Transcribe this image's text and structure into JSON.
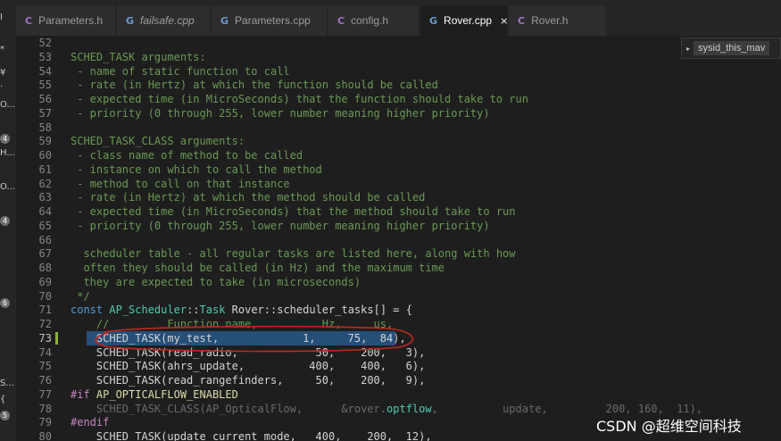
{
  "leftbar": {
    "items": [
      {
        "text": "Ï",
        "kind": "text"
      },
      {
        "text": "*",
        "kind": "text"
      },
      {
        "text": "¥",
        "kind": "text"
      },
      {
        "text": "·",
        "kind": "text"
      },
      {
        "text": "O...",
        "kind": "text"
      },
      {
        "text": "4",
        "kind": "badge"
      },
      {
        "text": "H...",
        "kind": "text"
      },
      {
        "text": "O...",
        "kind": "text"
      },
      {
        "text": "4",
        "kind": "badge"
      },
      {
        "text": "6",
        "kind": "badge"
      },
      {
        "text": "S...",
        "kind": "text"
      },
      {
        "text": "{",
        "kind": "text"
      },
      {
        "text": "5",
        "kind": "badge"
      }
    ]
  },
  "tabs": [
    {
      "label": "Parameters.h",
      "icon": "C",
      "lang": "c",
      "italic": false,
      "active": false
    },
    {
      "label": "failsafe.cpp",
      "icon": "G",
      "lang": "cpp",
      "italic": true,
      "active": false
    },
    {
      "label": "Parameters.cpp",
      "icon": "G",
      "lang": "cpp",
      "italic": false,
      "active": false
    },
    {
      "label": "config.h",
      "icon": "C",
      "lang": "c",
      "italic": false,
      "active": false
    },
    {
      "label": "Rover.cpp",
      "icon": "G",
      "lang": "cpp",
      "italic": false,
      "active": true,
      "close": "×"
    },
    {
      "label": "Rover.h",
      "icon": "C",
      "lang": "c",
      "italic": false,
      "active": false
    }
  ],
  "outline": {
    "arrow": "▸",
    "label": "sysid_this_mav"
  },
  "editor": {
    "active_line": 73,
    "lines": [
      {
        "n": 52,
        "tokens": []
      },
      {
        "n": 53,
        "tokens": [
          {
            "t": "SCHED_TASK arguments:",
            "c": "comment"
          }
        ]
      },
      {
        "n": 54,
        "tokens": [
          {
            "t": " - name of static function to call",
            "c": "comment"
          }
        ]
      },
      {
        "n": 55,
        "tokens": [
          {
            "t": " - rate (in Hertz) at which the function should be called",
            "c": "comment"
          }
        ]
      },
      {
        "n": 56,
        "tokens": [
          {
            "t": " - expected time (in MicroSeconds) that the function should take to run",
            "c": "comment"
          }
        ]
      },
      {
        "n": 57,
        "tokens": [
          {
            "t": " - priority (0 through 255, lower number meaning higher priority)",
            "c": "comment"
          }
        ]
      },
      {
        "n": 58,
        "tokens": []
      },
      {
        "n": 59,
        "tokens": [
          {
            "t": "SCHED_TASK_CLASS arguments:",
            "c": "comment"
          }
        ]
      },
      {
        "n": 60,
        "tokens": [
          {
            "t": " - class name of method to be called",
            "c": "comment"
          }
        ]
      },
      {
        "n": 61,
        "tokens": [
          {
            "t": " - instance on which to call the method",
            "c": "comment"
          }
        ]
      },
      {
        "n": 62,
        "tokens": [
          {
            "t": " - method to call on that instance",
            "c": "comment"
          }
        ]
      },
      {
        "n": 63,
        "tokens": [
          {
            "t": " - rate (in Hertz) at which the method should be called",
            "c": "comment"
          }
        ]
      },
      {
        "n": 64,
        "tokens": [
          {
            "t": " - expected time (in MicroSeconds) that the method should take to run",
            "c": "comment"
          }
        ]
      },
      {
        "n": 65,
        "tokens": [
          {
            "t": " - priority (0 through 255, lower number meaning higher priority)",
            "c": "comment"
          }
        ]
      },
      {
        "n": 66,
        "tokens": []
      },
      {
        "n": 67,
        "tokens": [
          {
            "t": "  scheduler table - all regular tasks are listed here, along with how",
            "c": "comment"
          }
        ]
      },
      {
        "n": 68,
        "tokens": [
          {
            "t": "  often they should be called (in Hz) and the maximum time",
            "c": "comment"
          }
        ]
      },
      {
        "n": 69,
        "tokens": [
          {
            "t": "  they are expected to take (in microseconds)",
            "c": "comment"
          }
        ]
      },
      {
        "n": 70,
        "tokens": [
          {
            "t": " */",
            "c": "comment"
          }
        ]
      },
      {
        "n": 71,
        "tokens": [
          {
            "t": "const ",
            "c": "keyword"
          },
          {
            "t": "AP_Scheduler",
            "c": "type"
          },
          {
            "t": "::",
            "c": "plain"
          },
          {
            "t": "Task",
            "c": "type"
          },
          {
            "t": " Rover::scheduler_tasks[] = {",
            "c": "plain"
          }
        ]
      },
      {
        "n": 72,
        "tokens": [
          {
            "t": "    //         Function name,          Hz,     us,",
            "c": "comment"
          }
        ]
      },
      {
        "n": 73,
        "tokens": [
          {
            "t": "    SCHED_TASK(my_test,             1,     75,  84),",
            "c": "plain"
          }
        ]
      },
      {
        "n": 74,
        "tokens": [
          {
            "t": "    SCHED_TASK(read_radio,            50,    200,   3),",
            "c": "plain"
          }
        ]
      },
      {
        "n": 75,
        "tokens": [
          {
            "t": "    SCHED_TASK(ahrs_update,          400,    400,   6),",
            "c": "plain"
          }
        ]
      },
      {
        "n": 76,
        "tokens": [
          {
            "t": "    SCHED_TASK(read_rangefinders,     50,    200,   9),",
            "c": "plain"
          }
        ]
      },
      {
        "n": 77,
        "tokens": [
          {
            "t": "#if ",
            "c": "preproc"
          },
          {
            "t": "AP_OPTICALFLOW_ENABLED",
            "c": "macro"
          }
        ]
      },
      {
        "n": 78,
        "tokens": [
          {
            "t": "    SCHED_TASK_CLASS(AP_OpticalFlow,      &rover.",
            "c": "dim"
          },
          {
            "t": "optflow",
            "c": "type"
          },
          {
            "t": ",          update,         200, 160,  11),",
            "c": "dim"
          }
        ]
      },
      {
        "n": 79,
        "tokens": [
          {
            "t": "#endif",
            "c": "preproc"
          }
        ]
      },
      {
        "n": 80,
        "tokens": [
          {
            "t": "    SCHED_TASK(update_current_mode,   400,    200,  12),",
            "c": "plain"
          }
        ]
      }
    ]
  },
  "annotation": {
    "color": "#c0281e"
  },
  "watermark": {
    "text": "CSDN @超维空间科技"
  }
}
